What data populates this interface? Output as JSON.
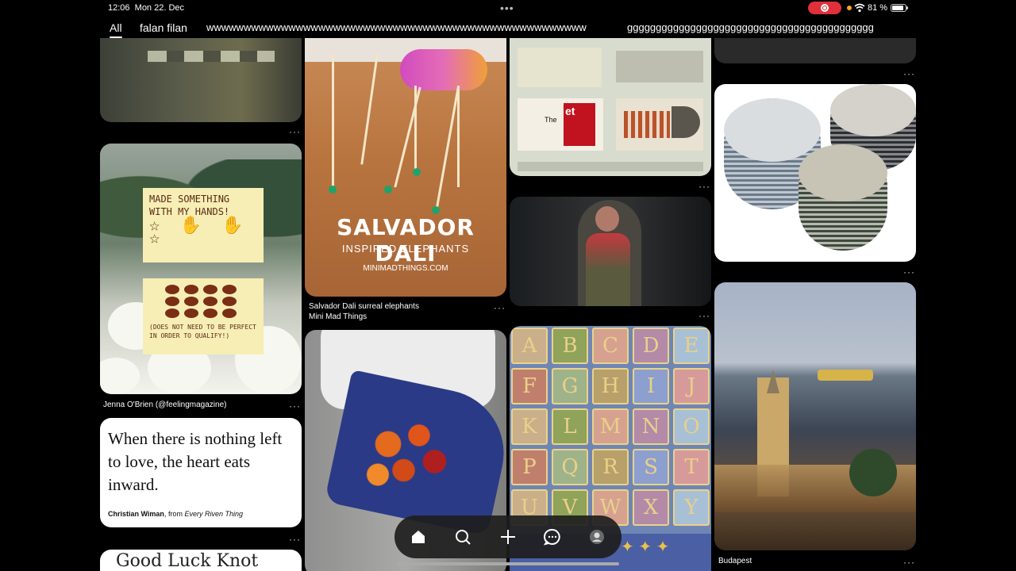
{
  "status_bar": {
    "time": "12:06",
    "date": "Mon 22. Dec",
    "battery_pct": "81 %",
    "recording_color": "#e0303a"
  },
  "tabs": [
    {
      "label": "All",
      "active": true
    },
    {
      "label": "falan filan",
      "active": false
    },
    {
      "label": "wwwwwwwwwwwwwwwwwwwwwwwwwwwwwwwwwwwwwwwwwwwwwwwwwww",
      "active": false
    },
    {
      "label": "ggggggggggggggggggggggggggggggggggggggggggg",
      "active": false
    }
  ],
  "pins": {
    "jenna": {
      "note_top": "MADE SOMETHING WITH MY HANDS!",
      "note_bottom": "(DOES NOT NEED TO BE PERFECT IN ORDER TO QUALIFY!)",
      "caption": "Jenna O'Brien (@feelingmagazine)"
    },
    "salvador": {
      "title": "SALVADOR DALI",
      "subtitle": "INSPIRED ELEPHANTS",
      "site": "MINIMADTHINGS.COM",
      "caption_title": "Salvador Dali surreal elephants",
      "caption_source": "Mini Mad Things"
    },
    "collage": {
      "red_text": "et",
      "word": "The"
    },
    "quote": {
      "text": "When there is nothing left to love, the heart eats inward.",
      "author": "Christian Wiman",
      "from": ", from ",
      "book": "Every Riven Thing"
    },
    "luck": {
      "text": "Good Luck Knot"
    },
    "alphabet": {
      "letters": [
        "A",
        "B",
        "C",
        "D",
        "E",
        "F",
        "G",
        "H",
        "I",
        "J",
        "K",
        "L",
        "M",
        "N",
        "O",
        "P",
        "Q",
        "R",
        "S",
        "T",
        "U",
        "V",
        "W",
        "X",
        "Y"
      ]
    },
    "budapest": {
      "caption": "Budapest"
    }
  },
  "more_icon": "···",
  "nav": {
    "items": [
      "home-icon",
      "search-icon",
      "create-icon",
      "messages-icon",
      "profile-icon"
    ]
  }
}
